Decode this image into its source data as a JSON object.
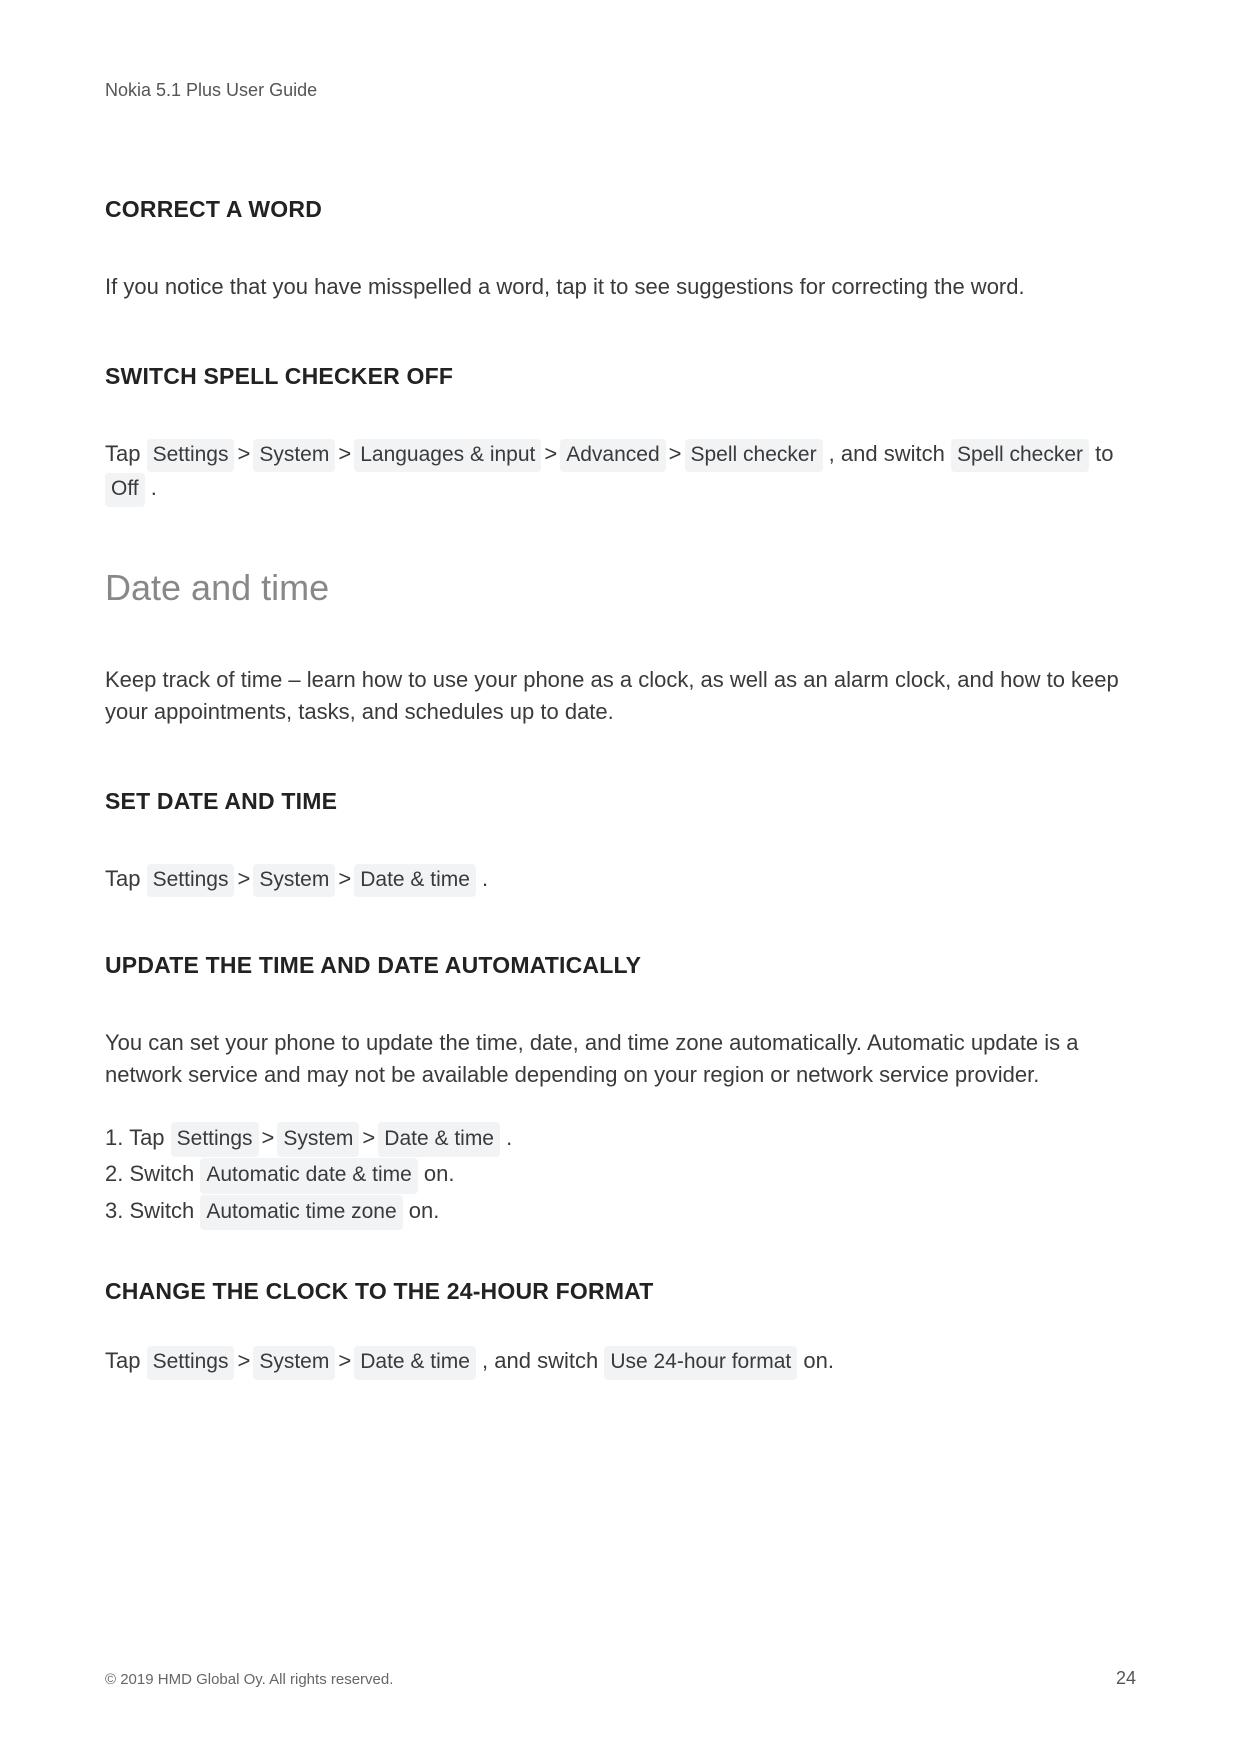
{
  "header": "Nokia 5.1 Plus User Guide",
  "sections": [
    {
      "heading": "CORRECT A WORD",
      "body_before": "If you notice that you have misspelled a word, tap it to see suggestions for correcting the word.",
      "chips": [],
      "body_after": ""
    },
    {
      "heading": "SWITCH SPELL CHECKER OFF",
      "body_before": "Tap ",
      "chips_path": [
        {
          "text": "Settings"
        },
        {
          "sep": ">"
        },
        {
          "text": "System"
        },
        {
          "sep": ">"
        },
        {
          "text": "Languages & input"
        },
        {
          "sep": ">"
        },
        {
          "text": "Advanced"
        },
        {
          "sep": ">"
        },
        {
          "text": "Spell checker"
        }
      ],
      "body_mid": " , and switch ",
      "chip_single1": "Spell checker",
      "body_mid2": " to ",
      "chip_single2": "Off",
      "body_after": " ."
    }
  ],
  "main_section": {
    "title": "Date and time",
    "intro": "Keep track of time – learn how to use your phone as a clock, as well as an alarm clock, and how to keep your appointments, tasks, and schedules up to date."
  },
  "set_date_time": {
    "heading": "SET DATE AND TIME",
    "prefix": "Tap ",
    "chips": [
      {
        "text": "Settings"
      },
      {
        "sep": ">"
      },
      {
        "text": "System"
      },
      {
        "sep": ">"
      },
      {
        "text": "Date & time"
      }
    ],
    "suffix": " ."
  },
  "auto_update": {
    "heading": "UPDATE THE TIME AND DATE AUTOMATICALLY",
    "intro": "You can set your phone to update the time, date, and time zone automatically. Automatic update is a network service and may not be available depending on your region or network service provider.",
    "step1_prefix": "1. Tap ",
    "step1_chips": [
      {
        "text": "Settings"
      },
      {
        "sep": ">"
      },
      {
        "text": "System"
      },
      {
        "sep": ">"
      },
      {
        "text": "Date & time"
      }
    ],
    "step1_suffix": " .",
    "step2_prefix": "2. Switch ",
    "step2_chip": "Automatic date & time",
    "step2_suffix": " on.",
    "step3_prefix": "3. Switch ",
    "step3_chip": "Automatic time zone",
    "step3_suffix": " on."
  },
  "clock_24h": {
    "heading": "CHANGE THE CLOCK TO THE 24-HOUR FORMAT",
    "prefix": "Tap ",
    "chips": [
      {
        "text": "Settings"
      },
      {
        "sep": ">"
      },
      {
        "text": "System"
      },
      {
        "sep": ">"
      },
      {
        "text": "Date & time"
      }
    ],
    "mid": " , and switch ",
    "chip2": "Use 24-hour format",
    "suffix": " on."
  },
  "footer": {
    "copyright": "© 2019 HMD Global Oy. All rights reserved.",
    "page": "24"
  }
}
